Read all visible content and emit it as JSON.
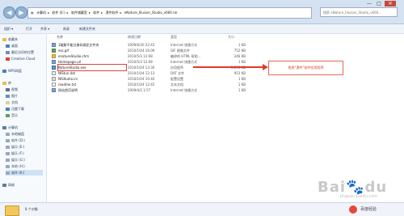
{
  "titlebar": {
    "path": [
      "计算机",
      "软件 (E:)",
      "软件储藏室",
      "软件",
      "漂件软件",
      "eNature_Illusion_Studio_v660.rar"
    ],
    "search_placeholder": "搜索 eNature_Illusion_Studio_v660...",
    "min": "—",
    "max": "□",
    "close": "✕"
  },
  "toolbar": {
    "organize": "组织 ▾",
    "open": "打开",
    "share": "共享 ▾",
    "burn": "刻录",
    "newfolder": "新建文件夹"
  },
  "sidebar": {
    "items": [
      "收藏夹",
      "桌面",
      "最近访问的位置",
      "Creative Cloud",
      "WPS网盘",
      "库",
      "视频",
      "图片",
      "文档",
      "迅雷下载",
      "音乐",
      "计算机",
      "本地磁盘",
      "软件 (D:)",
      "娱乐 (E:)",
      "娱乐 (F:)",
      "娱乐 (G:)",
      "本地 (H:)",
      "软件 (K:)",
      "网络"
    ]
  },
  "columns": {
    "name": "名称",
    "date": "修改日期",
    "type": "类型",
    "size": "大小"
  },
  "files": [
    {
      "name": "1破解不能注册码绑定文件夹",
      "date": "2009/6/30 22:43",
      "type": "Internet 快捷方式",
      "size": "1 KB"
    },
    {
      "name": "ess.gif",
      "date": "2010/10/4 16:09",
      "type": "GIF 图像文件",
      "size": "752 KB"
    },
    {
      "name": "enatureStudio.chm",
      "date": "2010/5/3 12:08",
      "type": "编译的 HTML 帮助...",
      "size": "246 KB"
    },
    {
      "name": "Homepage.url",
      "date": "2010/5/3 12:08",
      "type": "Internet 快捷方式",
      "size": "1 KB"
    },
    {
      "name": "NatureStudio.exe",
      "date": "2010/10/4 13:30",
      "type": "应用程序",
      "size": "3,393 KB"
    },
    {
      "name": "NlStun.dat",
      "date": "2010/10/4 12:13",
      "type": "DAT 文件",
      "size": "953 KB"
    },
    {
      "name": "NlSItudio.ini",
      "date": "2010/10/4 10:40",
      "type": "配置设置",
      "size": "1 KB"
    },
    {
      "name": "readme.txt",
      "date": "2010/10/4 12:45",
      "type": "文本文档",
      "size": "1 KB"
    },
    {
      "name": "网站首页说明",
      "date": "2009/4/2 1:57",
      "type": "Internet 快捷方式",
      "size": "1 KB"
    }
  ],
  "callout": "找到“漂件”软件应用程序",
  "status": {
    "count": "8 个对象"
  },
  "watermark": {
    "main": "Bai",
    "paw": "du",
    "sub": "jingyan.baidu.com",
    "corner": "百度经验"
  },
  "colors": {
    "accent": "#e03c2a",
    "selection_box": "#e04040",
    "window_frame": "#d5e2f1"
  }
}
